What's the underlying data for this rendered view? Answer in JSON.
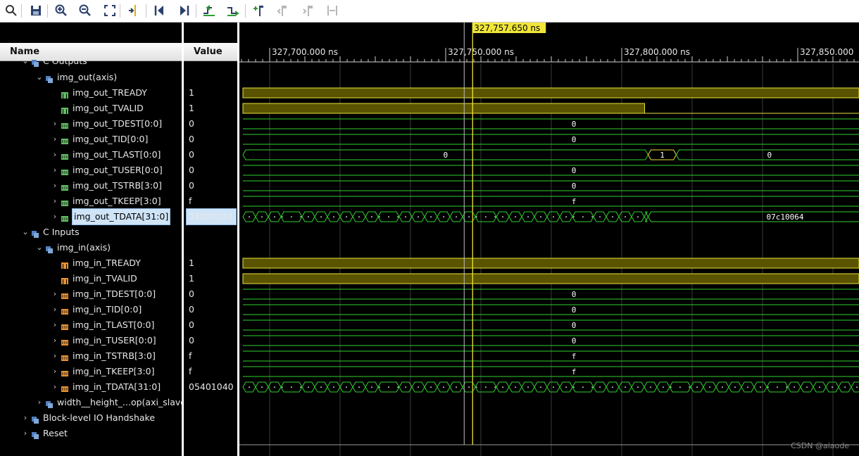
{
  "toolbar": {
    "buttons": [
      {
        "name": "search-icon"
      },
      {
        "name": "save-icon"
      },
      {
        "name": "zoom-in-icon"
      },
      {
        "name": "zoom-out-icon"
      },
      {
        "name": "zoom-fit-icon"
      },
      {
        "name": "go-to-cursor-icon"
      },
      {
        "name": "go-to-time-0-icon"
      },
      {
        "name": "go-to-last-time-icon"
      },
      {
        "name": "previous-transition-icon"
      },
      {
        "name": "next-transition-icon"
      },
      {
        "name": "add-marker-icon"
      },
      {
        "name": "previous-marker-icon"
      },
      {
        "name": "next-marker-icon"
      },
      {
        "name": "swap-cursors-icon"
      }
    ]
  },
  "headers": {
    "name": "Name",
    "value": "Value"
  },
  "cursor": {
    "label": "327,757.650 ns"
  },
  "time_ruler": [
    {
      "label": "327,700.000 ns"
    },
    {
      "label": "327,750.000 ns"
    },
    {
      "label": "327,800.000 ns"
    },
    {
      "label": "327,850.000"
    }
  ],
  "tree": [
    {
      "label": "C Outputs",
      "value": "",
      "kind": "group",
      "cut": true
    },
    {
      "label": "img_out(axis)",
      "value": "",
      "kind": "iface"
    },
    {
      "label": "img_out_TREADY",
      "value": "1",
      "kind": "wire",
      "dir": "out"
    },
    {
      "label": "img_out_TVALID",
      "value": "1",
      "kind": "wire",
      "dir": "out"
    },
    {
      "label": "img_out_TDEST[0:0]",
      "value": "0",
      "kind": "bus",
      "dir": "out"
    },
    {
      "label": "img_out_TID[0:0]",
      "value": "0",
      "kind": "bus",
      "dir": "out"
    },
    {
      "label": "img_out_TLAST[0:0]",
      "value": "0",
      "kind": "bus",
      "dir": "out"
    },
    {
      "label": "img_out_TUSER[0:0]",
      "value": "0",
      "kind": "bus",
      "dir": "out"
    },
    {
      "label": "img_out_TSTRB[3:0]",
      "value": "0",
      "kind": "bus",
      "dir": "out"
    },
    {
      "label": "img_out_TKEEP[3:0]",
      "value": "f",
      "kind": "bus",
      "dir": "out"
    },
    {
      "label": "img_out_TDATA[31:0]",
      "value": "03000024",
      "kind": "bus",
      "dir": "out",
      "selected": true
    },
    {
      "label": "C Inputs",
      "value": "",
      "kind": "group"
    },
    {
      "label": "img_in(axis)",
      "value": "",
      "kind": "iface"
    },
    {
      "label": "img_in_TREADY",
      "value": "1",
      "kind": "wire",
      "dir": "in"
    },
    {
      "label": "img_in_TVALID",
      "value": "1",
      "kind": "wire",
      "dir": "in"
    },
    {
      "label": "img_in_TDEST[0:0]",
      "value": "0",
      "kind": "bus",
      "dir": "in"
    },
    {
      "label": "img_in_TID[0:0]",
      "value": "0",
      "kind": "bus",
      "dir": "in"
    },
    {
      "label": "img_in_TLAST[0:0]",
      "value": "0",
      "kind": "bus",
      "dir": "in"
    },
    {
      "label": "img_in_TUSER[0:0]",
      "value": "0",
      "kind": "bus",
      "dir": "in"
    },
    {
      "label": "img_in_TSTRB[3:0]",
      "value": "f",
      "kind": "bus",
      "dir": "in"
    },
    {
      "label": "img_in_TKEEP[3:0]",
      "value": "f",
      "kind": "bus",
      "dir": "in"
    },
    {
      "label": "img_in_TDATA[31:0]",
      "value": "05401040",
      "kind": "bus",
      "dir": "in"
    },
    {
      "label": "width__height_...op(axi_slave",
      "value": "",
      "kind": "iface"
    },
    {
      "label": "Block-level IO Handshake",
      "value": "",
      "kind": "group"
    },
    {
      "label": "Reset",
      "value": "",
      "kind": "group"
    }
  ],
  "waves": {
    "img_out_TREADY": {
      "type": "high"
    },
    "img_out_TVALID": {
      "type": "high_then_low",
      "fall_time_ns": 327806.5
    },
    "img_out_TDEST": {
      "type": "const",
      "text": "0"
    },
    "img_out_TID": {
      "type": "const",
      "text": "0"
    },
    "img_out_TLAST": {
      "type": "segments",
      "change_times_ns": [
        327807.5,
        327815.5
      ],
      "texts": [
        "0",
        "1",
        "0"
      ]
    },
    "img_out_TUSER": {
      "type": "const",
      "text": "0"
    },
    "img_out_TSTRB": {
      "type": "const",
      "text": "0"
    },
    "img_out_TKEEP": {
      "type": "const",
      "text": "f"
    },
    "img_out_TDATA": {
      "type": "busy_then_const",
      "busy_end_ns": 327807.5,
      "text": "07c10064"
    },
    "img_in_TREADY": {
      "type": "high"
    },
    "img_in_TVALID": {
      "type": "high"
    },
    "img_in_TDEST": {
      "type": "const",
      "text": "0"
    },
    "img_in_TID": {
      "type": "const",
      "text": "0"
    },
    "img_in_TLAST": {
      "type": "const",
      "text": "0"
    },
    "img_in_TUSER": {
      "type": "const",
      "text": "0"
    },
    "img_in_TSTRB": {
      "type": "const",
      "text": "f"
    },
    "img_in_TKEEP": {
      "type": "const",
      "text": "f"
    },
    "img_in_TDATA": {
      "type": "busy"
    }
  },
  "watermark": "CSDN @aiaode",
  "colors": {
    "wave": "#2fcf2f",
    "high_fill": "#5a5400",
    "high_line": "#e8e23a",
    "cursor": "#f0e63a"
  }
}
